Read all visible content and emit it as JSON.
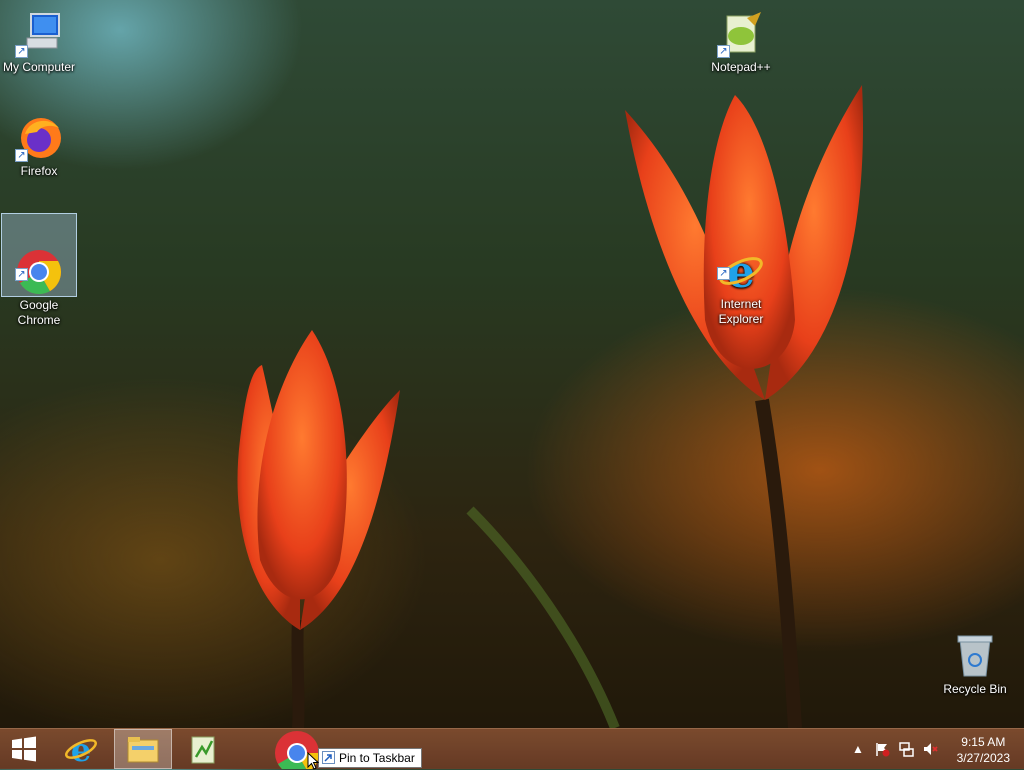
{
  "desktop": {
    "icons": [
      {
        "label": "My Computer",
        "icon": "computer-icon"
      },
      {
        "label": "Firefox",
        "icon": "firefox-icon"
      },
      {
        "label": "Google\nChrome",
        "icon": "chrome-icon",
        "selected": true
      },
      {
        "label": "Notepad++",
        "icon": "notepadpp-icon"
      },
      {
        "label": "Internet\nExplorer",
        "icon": "ie-icon"
      },
      {
        "label": "Recycle Bin",
        "icon": "recycle-bin-icon"
      }
    ]
  },
  "taskbar": {
    "start_icon": "windows-logo-icon",
    "pinned": [
      {
        "icon": "ie-icon"
      },
      {
        "icon": "file-explorer-icon",
        "active": true
      },
      {
        "icon": "notepadpp-icon"
      }
    ],
    "dragging_icon": "chrome-icon",
    "tooltip": "Pin to Taskbar",
    "tray": {
      "icons": [
        "show-hidden-icons-icon",
        "action-center-flag-icon",
        "network-icon",
        "volume-muted-icon"
      ],
      "time": "9:15 AM",
      "date": "3/27/2023"
    }
  },
  "colors": {
    "taskbar": "#7a4a2e",
    "tulip": "#e8401a",
    "selection": "#bcdcff"
  }
}
